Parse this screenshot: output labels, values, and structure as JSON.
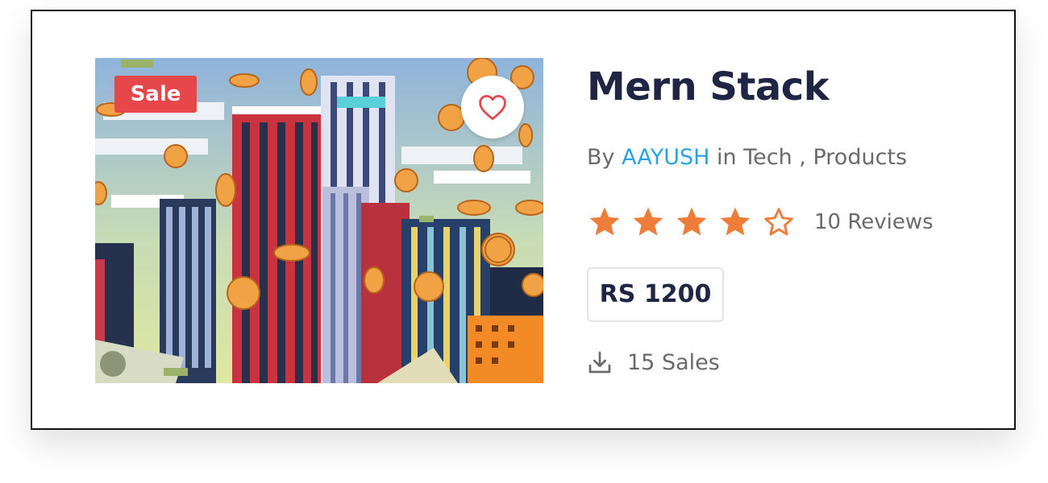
{
  "product": {
    "badge": "Sale",
    "title": "Mern Stack",
    "by_label": "By",
    "author": "AAYUSH",
    "in_label": "in",
    "categories": [
      "Tech",
      "Products"
    ],
    "separator": ",",
    "rating": 4,
    "rating_max": 5,
    "reviews_text": "10 Reviews",
    "price": "RS 1200",
    "sales_text": "15 Sales"
  },
  "icons": {
    "favorite": "heart-icon",
    "star_filled": "star-filled-icon",
    "star_empty": "star-outline-icon",
    "download": "download-icon"
  },
  "colors": {
    "badge_bg": "#e5474b",
    "accent_link": "#2aa3e6",
    "star": "#ef7d3a",
    "title": "#1f2542",
    "muted_text": "#6a6a6a",
    "heart": "#e5474b"
  }
}
